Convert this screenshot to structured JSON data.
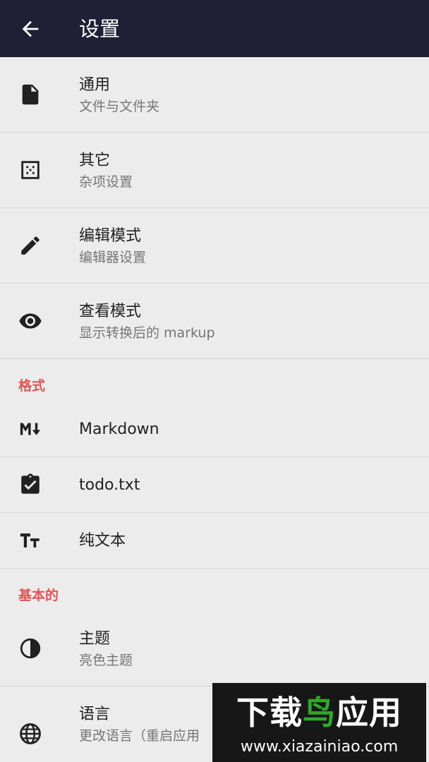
{
  "appbar": {
    "title": "设置",
    "back_icon": "arrow-back-icon"
  },
  "items_top": [
    {
      "icon": "file-icon",
      "title": "通用",
      "subtitle": "文件与文件夹"
    },
    {
      "icon": "dots-square-icon",
      "title": "其它",
      "subtitle": "杂项设置"
    },
    {
      "icon": "pencil-icon",
      "title": "编辑模式",
      "subtitle": "编辑器设置"
    },
    {
      "icon": "eye-icon",
      "title": "查看模式",
      "subtitle": "显示转换后的 markup"
    }
  ],
  "section_format": {
    "label": "格式"
  },
  "items_format": [
    {
      "icon": "markdown-icon",
      "title": "Markdown"
    },
    {
      "icon": "clipboard-check-icon",
      "title": "todo.txt"
    },
    {
      "icon": "text-size-icon",
      "title": "纯文本"
    }
  ],
  "section_basic": {
    "label": "基本的"
  },
  "items_basic": [
    {
      "icon": "contrast-icon",
      "title": "主题",
      "subtitle": "亮色主题"
    },
    {
      "icon": "globe-icon",
      "title": "语言",
      "subtitle": "更改语言（重启应用"
    }
  ],
  "watermark": {
    "brand_part1": "下载",
    "brand_part2": "鸟",
    "brand_part3": "应用",
    "url": "www.xiazainiao.com"
  },
  "colors": {
    "appbar": "#1f2035",
    "accent_section": "#e05454",
    "background": "#ececec"
  }
}
